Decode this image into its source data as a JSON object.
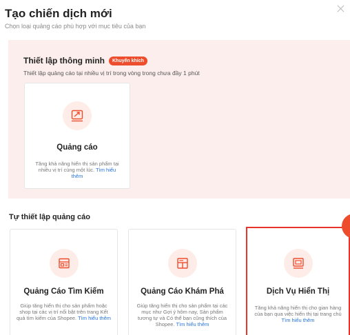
{
  "modal": {
    "title": "Tạo chiến dịch mới",
    "subtitle": "Chọn loại quảng cáo phù hợp với mục tiêu của bạn"
  },
  "smart": {
    "title": "Thiết lập thông minh",
    "badge": "Khuyến khích",
    "description": "Thiết lập quảng cáo tại nhiều vị trí trong vòng trong chưa đầy 1 phút",
    "card": {
      "icon": "trend-chart-icon",
      "title": "Quảng cáo",
      "description": "Tăng khả năng hiển thị sản phẩm tại nhiều vị trí cùng một lúc.",
      "link": "Tìm hiểu thêm"
    }
  },
  "manual": {
    "title": "Tự thiết lập quảng cáo",
    "cards": [
      {
        "icon": "search-ad-icon",
        "title": "Quảng Cáo Tìm Kiếm",
        "description": "Giúp tăng hiển thị cho sản phẩm hoặc shop tại các vị trí nổi bật trên trang Kết quả tìm kiếm của Shopee.",
        "link": "Tìm hiểu thêm"
      },
      {
        "icon": "discovery-ad-icon",
        "title": "Quảng Cáo Khám Phá",
        "description": "Giúp tăng hiển thị cho sản phẩm tại các mục như Gợi ý hôm nay, Sản phẩm tương tự và Có thể bạn cũng thích của Shopee.",
        "link": "Tìm hiểu thêm"
      },
      {
        "icon": "display-ad-icon",
        "title": "Dịch Vụ Hiển Thị",
        "description": "Tăng khả năng hiển thị cho gian hàng của bạn qua việc hiển thị tại trang chủ",
        "link": "Tìm hiểu thêm"
      }
    ]
  },
  "colors": {
    "accent": "#ee4d2d",
    "highlight_border": "#e8322a",
    "smart_bg": "#fbeeed",
    "link": "#2673dd"
  }
}
